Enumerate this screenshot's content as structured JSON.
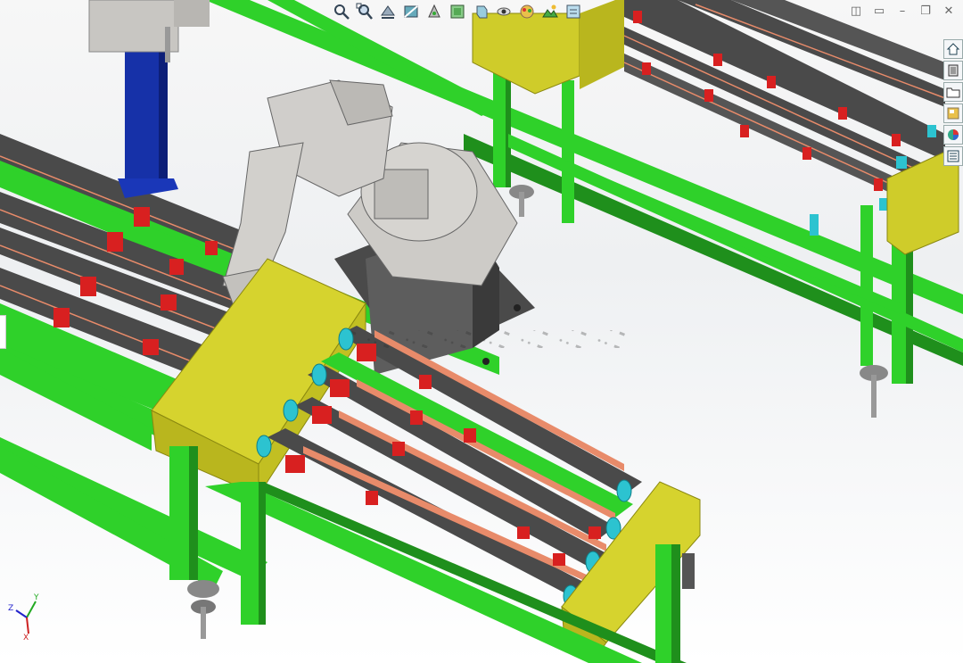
{
  "window": {
    "controls": [
      "◫",
      "▭",
      "–",
      "❐",
      "✕"
    ]
  },
  "heads_up_toolbar": {
    "tools": [
      {
        "icon": "zoom-to-fit-icon"
      },
      {
        "icon": "zoom-to-area-icon"
      },
      {
        "icon": "previous-view-icon"
      },
      {
        "icon": "section-view-icon"
      },
      {
        "icon": "dynamic-annotation-icon"
      },
      {
        "icon": "view-orientation-icon"
      },
      {
        "icon": "display-style-icon"
      },
      {
        "icon": "hide-show-items-icon"
      },
      {
        "icon": "edit-appearance-icon"
      },
      {
        "icon": "apply-scene-icon"
      },
      {
        "icon": "view-settings-icon"
      }
    ]
  },
  "task_pane": {
    "tabs": [
      {
        "icon": "home-icon"
      },
      {
        "icon": "design-library-icon"
      },
      {
        "icon": "file-explorer-icon"
      },
      {
        "icon": "view-palette-icon"
      },
      {
        "icon": "appearances-icon"
      },
      {
        "icon": "custom-properties-icon"
      }
    ]
  },
  "triad": {
    "x_label": "X",
    "y_label": "Y",
    "z_label": "Z"
  },
  "colors": {
    "frame_green": "#2fd12a",
    "frame_dark": "#1f8f1c",
    "yellow_housing": "#cfcc2a",
    "rail_dark": "#4a4a4a",
    "clamp_red": "#d82020",
    "robot_grey": "#c8c6c2",
    "pedestal_blue": "#1631a8",
    "fixture_cyan": "#2cc3d0"
  }
}
